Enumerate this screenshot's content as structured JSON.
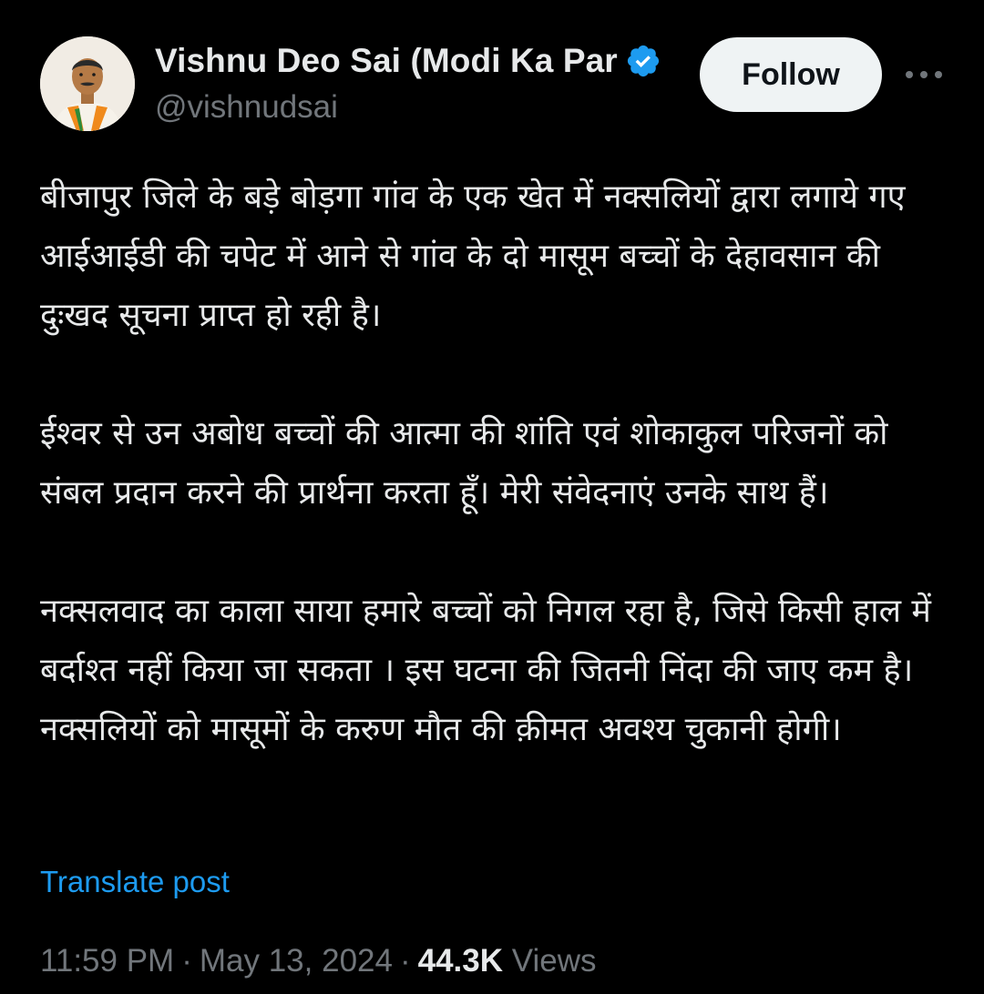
{
  "author": {
    "display_name": "Vishnu Deo Sai (Modi Ka Par",
    "handle": "@vishnudsai",
    "verified_icon": "verified-badge-icon",
    "verified_color": "#1d9bf0"
  },
  "actions": {
    "follow_label": "Follow",
    "more_icon": "more-horizontal-icon"
  },
  "post": {
    "paragraphs": [
      "बीजापुर जिले के बड़े बोड़गा गांव के एक खेत में नक्सलियों द्वारा लगाये गए आईआईडी की चपेट में आने से गांव के दो मासूम बच्चों के देहावसान की दुःखद सूचना प्राप्त हो रही है।",
      "ईश्वर से उन अबोध बच्चों की आत्मा की शांति एवं शोकाकुल परिजनों को संबल प्रदान करने की प्रार्थना करता हूँ। मेरी संवेदनाएं उनके साथ हैं।",
      "नक्सलवाद का काला साया हमारे बच्चों को निगल रहा है, जिसे किसी हाल में बर्दाश्त नहीं किया जा सकता । इस घटना की जितनी निंदा की जाए कम है। नक्सलियों को मासूमों के करुण मौत की क़ीमत अवश्य चुकानी होगी।"
    ],
    "translate_label": "Translate post"
  },
  "meta": {
    "time": "11:59 PM",
    "separator": "·",
    "date": "May 13, 2024",
    "views_count": "44.3K",
    "views_label": "Views"
  },
  "colors": {
    "background": "#000000",
    "text_primary": "#e7e9ea",
    "text_secondary": "#71767b",
    "link": "#1d9bf0",
    "follow_bg": "#eff3f4"
  }
}
